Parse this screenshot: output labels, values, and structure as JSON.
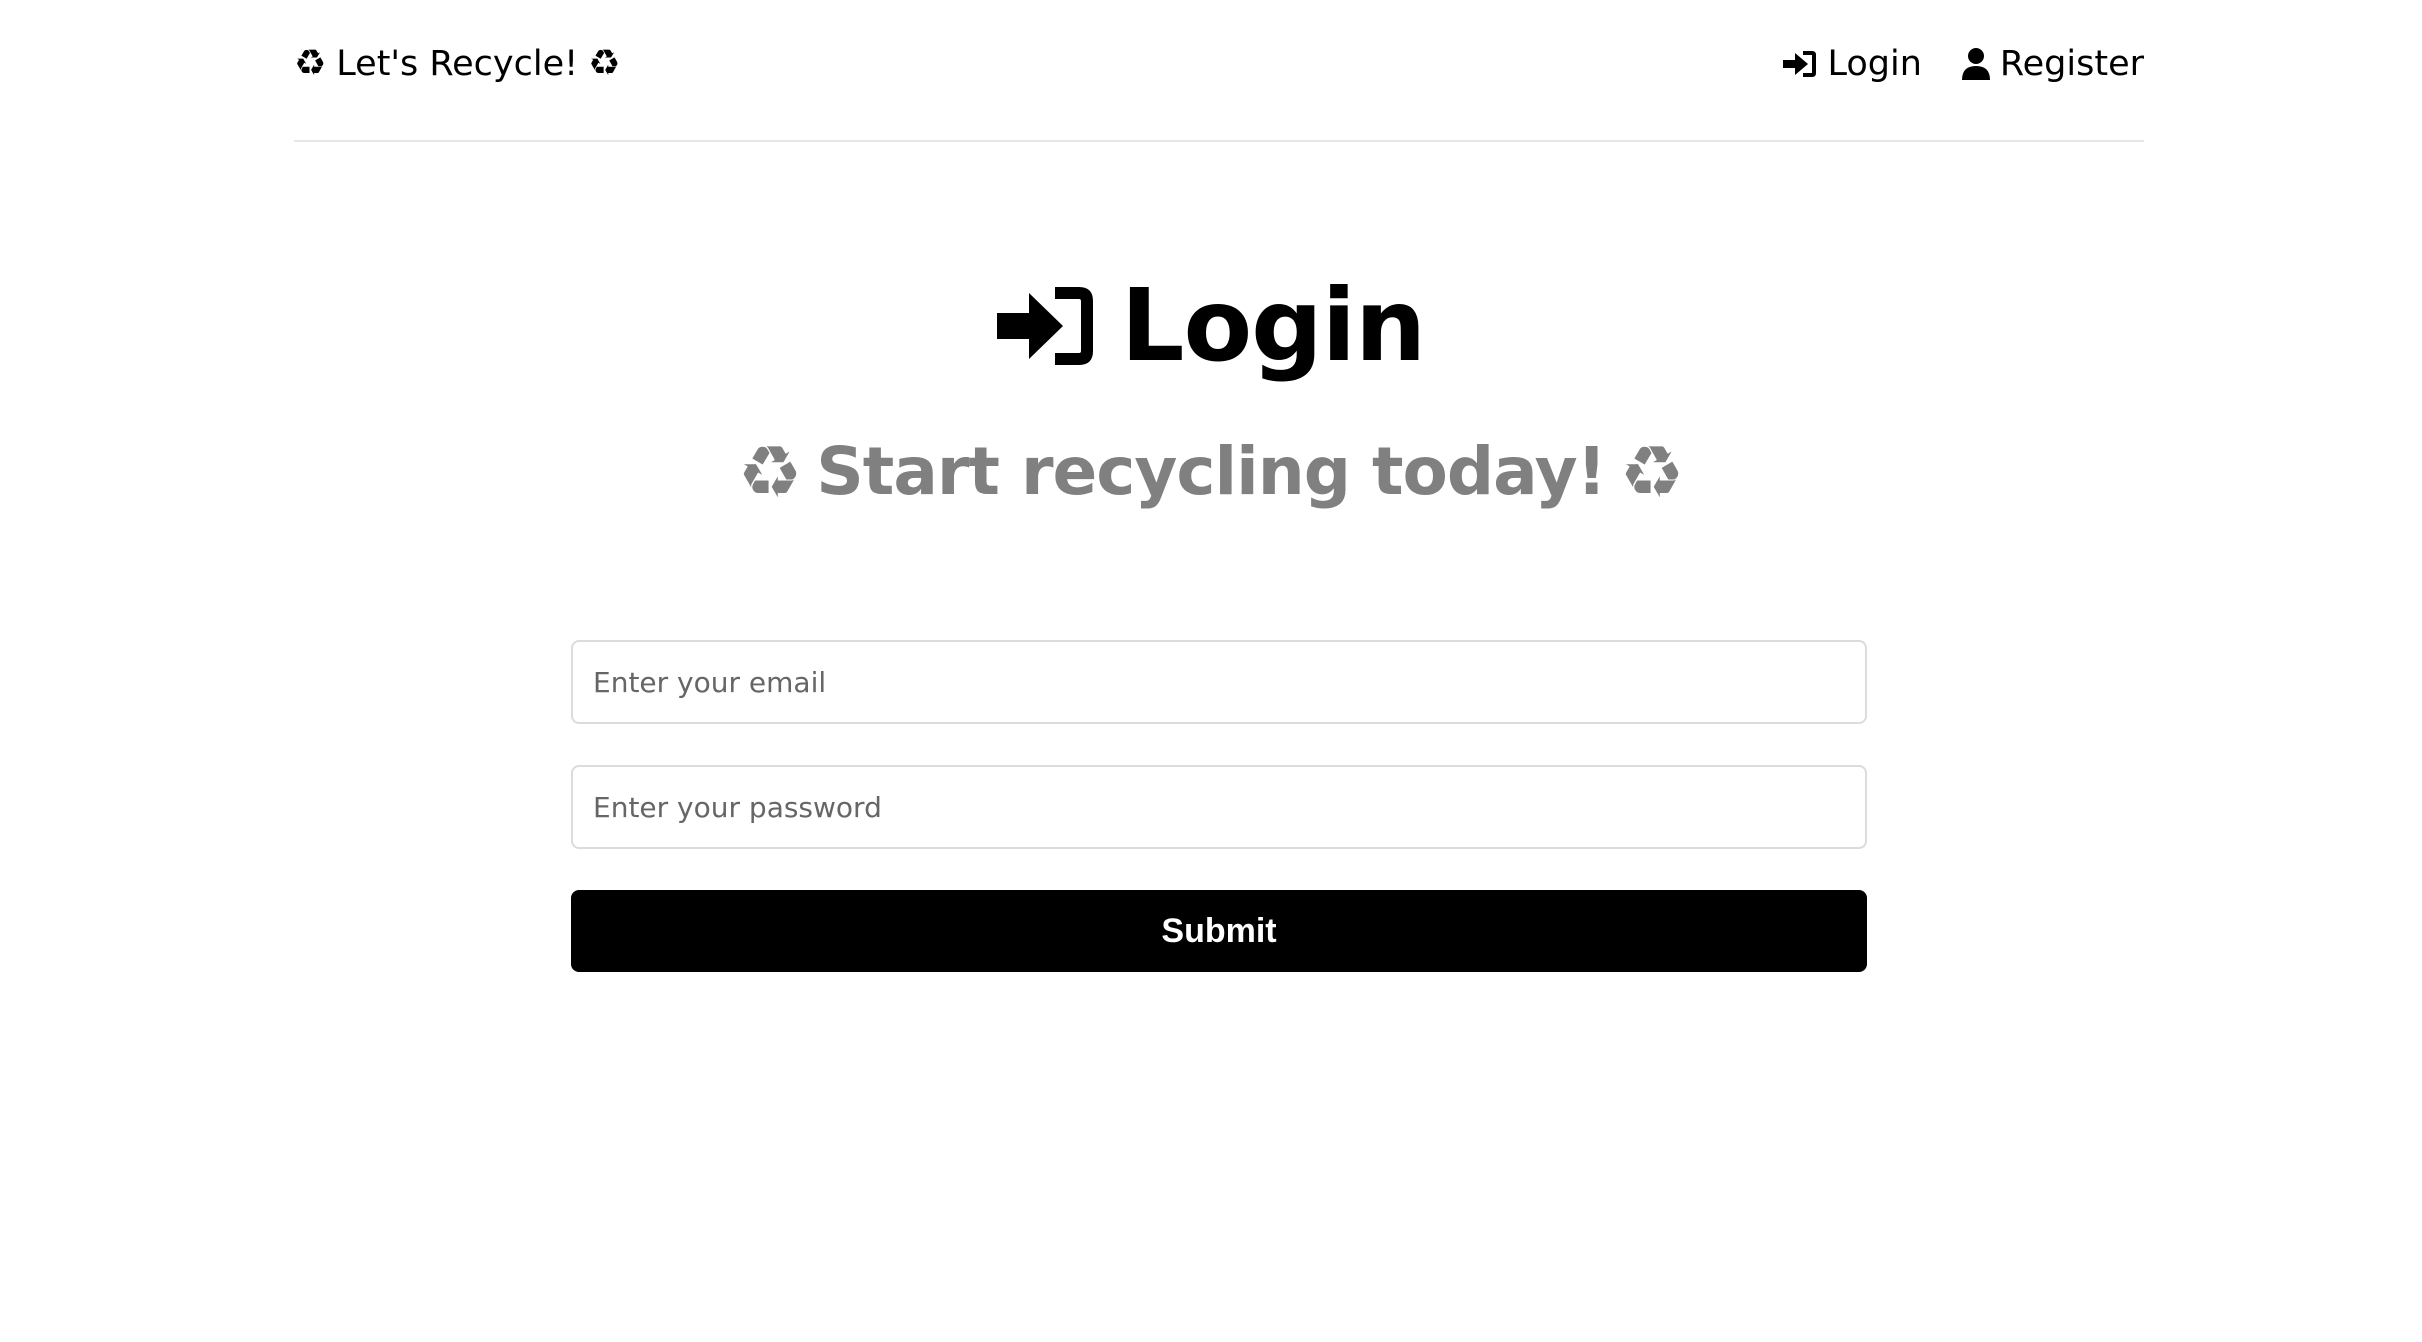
{
  "header": {
    "logo_icon_left": "♻",
    "logo_text": "Let's Recycle!",
    "logo_icon_right": "♻",
    "nav": [
      {
        "label": "Login",
        "icon": "sign-in-icon"
      },
      {
        "label": "Register",
        "icon": "user-icon"
      }
    ]
  },
  "main": {
    "title": "Login",
    "title_icon": "sign-in-icon",
    "subtitle_icon_left": "♻",
    "subtitle": "Start recycling today!",
    "subtitle_icon_right": "♻"
  },
  "form": {
    "email_placeholder": "Enter your email",
    "email_value": "",
    "password_placeholder": "Enter your password",
    "password_value": "",
    "submit_label": "Submit"
  },
  "colors": {
    "text": "#000000",
    "subtitle": "#808080",
    "button_bg": "#000000",
    "button_text": "#ffffff",
    "border": "#dcdcdc"
  }
}
